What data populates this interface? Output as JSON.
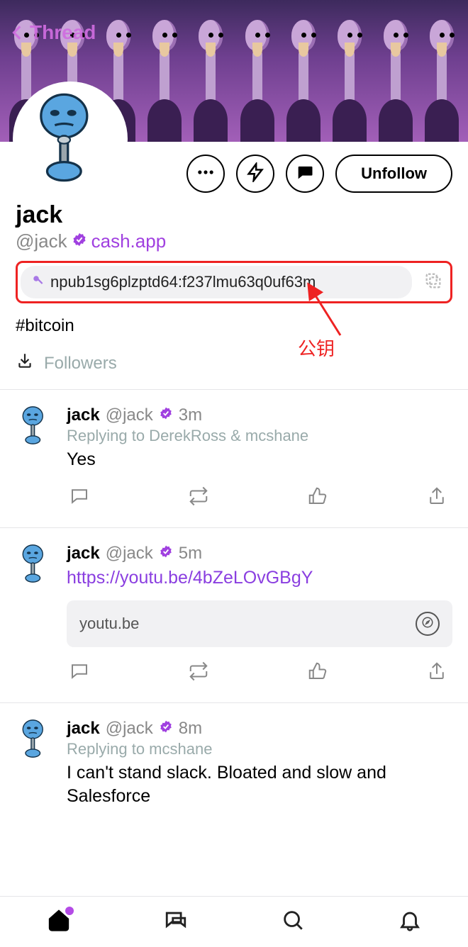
{
  "header": {
    "thread_label": "Thread"
  },
  "profile": {
    "display_name": "jack",
    "handle": "@jack",
    "website": "cash.app",
    "pubkey": "npub1sg6plzptd64:f237lmu63q0uf63m",
    "hashtag": "#bitcoin",
    "followers_label": "Followers",
    "unfollow_label": "Unfollow"
  },
  "annotation": {
    "pubkey_label": "公钥"
  },
  "posts": [
    {
      "name": "jack",
      "handle": "@jack",
      "time": "3m",
      "reply_to": "Replying to DerekRoss & mcshane",
      "content": "Yes",
      "link": null,
      "link_card": null
    },
    {
      "name": "jack",
      "handle": "@jack",
      "time": "5m",
      "reply_to": null,
      "content": null,
      "link": "https://youtu.be/4bZeLOvGBgY",
      "link_card": "youtu.be"
    },
    {
      "name": "jack",
      "handle": "@jack",
      "time": "8m",
      "reply_to": "Replying to mcshane",
      "content": "I can't stand slack. Bloated and slow and Salesforce",
      "link": null,
      "link_card": null
    }
  ]
}
